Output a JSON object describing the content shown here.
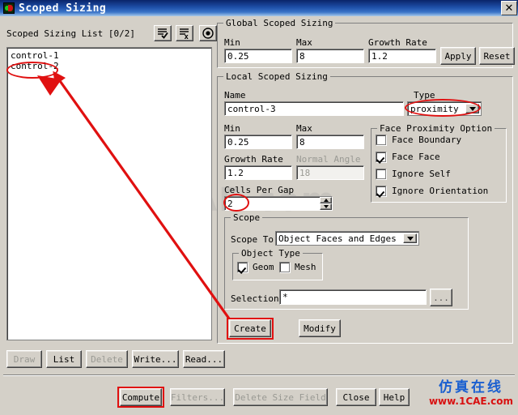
{
  "window": {
    "title": "Scoped Sizing",
    "icon": "app-icon",
    "close_label": "✕"
  },
  "left_panel": {
    "list_label": "Scoped Sizing List  [0/2]",
    "toolbar": [
      {
        "name": "select-all-icon",
        "tip": "select all"
      },
      {
        "name": "deselect-all-icon",
        "tip": "deselect all"
      },
      {
        "name": "select-filter-icon",
        "tip": "filter"
      }
    ],
    "items": [
      "control-1",
      "control-2"
    ],
    "buttons": [
      {
        "label": "Draw",
        "enabled": false
      },
      {
        "label": "List",
        "enabled": true
      },
      {
        "label": "Delete",
        "enabled": false
      },
      {
        "label": "Write...",
        "enabled": true
      },
      {
        "label": "Read...",
        "enabled": true
      }
    ]
  },
  "global_scoped_sizing": {
    "title": "Global Scoped Sizing",
    "min_label": "Min",
    "min_value": "0.25",
    "max_label": "Max",
    "max_value": "8",
    "growth_rate_label": "Growth Rate",
    "growth_rate_value": "1.2",
    "apply_label": "Apply",
    "reset_label": "Reset"
  },
  "local_scoped_sizing": {
    "title": "Local Scoped Sizing",
    "name_label": "Name",
    "name_value": "control-3",
    "type_label": "Type",
    "type_value": "proximity",
    "min_label": "Min",
    "min_value": "0.25",
    "max_label": "Max",
    "max_value": "8",
    "growth_rate_label": "Growth Rate",
    "growth_rate_value": "1.2",
    "normal_angle_label": "Normal Angle",
    "normal_angle_value": "18",
    "normal_angle_enabled": false,
    "cells_per_gap_label": "Cells Per Gap",
    "cells_per_gap_value": "2",
    "face_proximity": {
      "title": "Face Proximity Option",
      "options": [
        {
          "label": "Face Boundary",
          "checked": false
        },
        {
          "label": "Face Face",
          "checked": true
        },
        {
          "label": "Ignore Self",
          "checked": false
        },
        {
          "label": "Ignore Orientation",
          "checked": true
        }
      ]
    },
    "scope": {
      "title": "Scope",
      "scope_to_label": "Scope To",
      "scope_to_value": "Object Faces and Edges",
      "object_type_title": "Object Type",
      "object_types": [
        {
          "label": "Geom",
          "checked": true
        },
        {
          "label": "Mesh",
          "checked": false
        }
      ],
      "selections_label": "Selections",
      "selections_value": "*",
      "selections_browse_label": "..."
    },
    "create_label": "Create",
    "modify_label": "Modify"
  },
  "footer": {
    "buttons": [
      {
        "label": "Compute",
        "enabled": true
      },
      {
        "label": "Filters...",
        "enabled": false
      },
      {
        "label": "Delete Size Field",
        "enabled": false
      },
      {
        "label": "Close",
        "enabled": true
      },
      {
        "label": "Help",
        "enabled": true
      }
    ]
  },
  "watermark": {
    "center_text": "1CAE.com",
    "logo_cn": "仿真在线",
    "logo_en": "www.1CAE.com"
  },
  "annotations": {
    "highlight_color": "#e01010",
    "items": [
      {
        "name": "ellipse-control-2",
        "target": "control-2"
      },
      {
        "name": "ellipse-type-proximity",
        "target": "proximity"
      },
      {
        "name": "ellipse-cells-per-gap",
        "target": "2"
      },
      {
        "name": "box-create",
        "target": "Create"
      },
      {
        "name": "box-compute",
        "target": "Compute"
      },
      {
        "name": "arrow-create-to-control-2",
        "target": "control-2"
      }
    ]
  }
}
